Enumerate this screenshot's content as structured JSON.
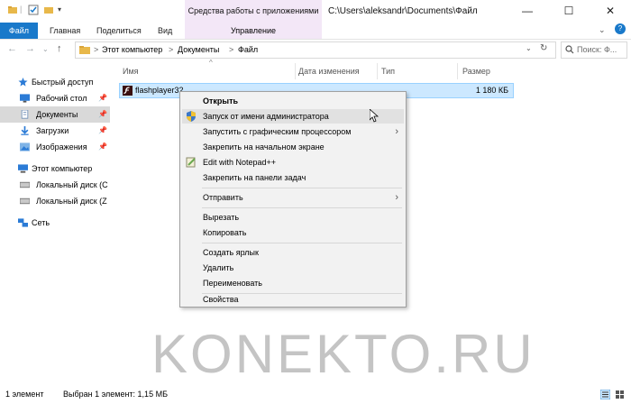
{
  "titlebar": {
    "context_group": "Средства работы с приложениями",
    "path": "C:\\Users\\aleksandr\\Documents\\Файл",
    "minimize": "—",
    "maximize": "☐",
    "close": "✕",
    "help": "?"
  },
  "ribbon": {
    "tabs": [
      "Файл",
      "Главная",
      "Поделиться",
      "Вид"
    ],
    "context_tab": "Управление"
  },
  "address": {
    "crumbs": [
      "Этот компьютер",
      "Документы",
      "Файл"
    ],
    "separator": ">",
    "search_placeholder": "Поиск: Ф..."
  },
  "nav_pane": {
    "items": [
      {
        "label": "Быстрый доступ",
        "icon": "star-icon"
      },
      {
        "label": "Рабочий стол",
        "icon": "desktop-icon",
        "pinned": true
      },
      {
        "label": "Документы",
        "icon": "documents-icon",
        "pinned": true,
        "selected": true
      },
      {
        "label": "Загрузки",
        "icon": "download-icon",
        "pinned": true
      },
      {
        "label": "Изображения",
        "icon": "pictures-icon",
        "pinned": true
      },
      {
        "label": "Этот компьютер",
        "icon": "computer-icon"
      },
      {
        "label": "Локальный диск (C",
        "icon": "drive-icon"
      },
      {
        "label": "Локальный диск (Z",
        "icon": "drive-icon"
      },
      {
        "label": "Сеть",
        "icon": "network-icon"
      }
    ]
  },
  "columns": [
    "Имя",
    "Дата изменения",
    "Тип",
    "Размер"
  ],
  "file": {
    "name": "flashplayer32...",
    "date": "...",
    "type": "...",
    "size": "1 180 КБ"
  },
  "context_menu": {
    "items": [
      {
        "label": "Открыть",
        "bold": true
      },
      {
        "label": "Запуск от имени администратора",
        "icon": "shield-icon",
        "hover": true
      },
      {
        "label": "Запустить с графическим процессором",
        "submenu": true
      },
      {
        "label": "Закрепить на начальном экране"
      },
      {
        "label": "Edit with Notepad++",
        "icon": "notepad-icon"
      },
      {
        "label": "Закрепить на панели задач"
      },
      {
        "separator": true
      },
      {
        "label": "Отправить",
        "submenu": true
      },
      {
        "separator": true
      },
      {
        "label": "Вырезать"
      },
      {
        "label": "Копировать"
      },
      {
        "separator": true
      },
      {
        "label": "Создать ярлык"
      },
      {
        "label": "Удалить"
      },
      {
        "label": "Переименовать"
      },
      {
        "separator": true
      },
      {
        "label": "Свойства"
      }
    ]
  },
  "status": {
    "count": "1 элемент",
    "selected": "Выбран 1 элемент: 1,15 МБ"
  },
  "watermark": "KONEKTO.RU",
  "colors": {
    "accent": "#1979ca",
    "context_tab": "#f3e7f7",
    "selection": "#cce8ff",
    "menu_bg": "#f2f2f2"
  }
}
